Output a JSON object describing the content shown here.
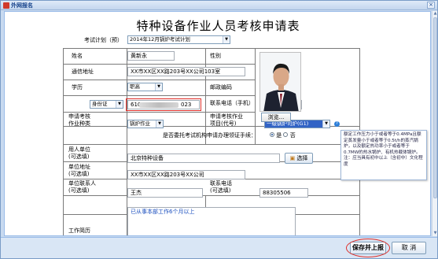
{
  "window": {
    "title": "外网报名",
    "close_glyph": "×"
  },
  "form": {
    "title": "特种设备作业人员考核申请表",
    "exam_plan_label": "考试计划（预）",
    "exam_plan_value": "2014年12月锅炉考试计划",
    "fields": {
      "name_label": "姓名",
      "name_value": "黄新永",
      "gender_label": "性别",
      "gender_male": "男",
      "gender_female": "女",
      "gender_selected": "female",
      "address_label": "通信地址",
      "address_value": "XX市XX区XX路203号XX公司103室",
      "education_label": "学历",
      "education_value": "职高",
      "postcode_label": "邮政编码",
      "postcode_value": "100000",
      "id_type_value": "身份证",
      "id_number_prefix": "610",
      "id_number_suffix": "023",
      "phone_label": "联系电话（手机）",
      "phone_value": "18900005500",
      "category_label_1": "申请考核",
      "category_label_2": "作业种类",
      "category_value": "锅炉作业",
      "project_label_1": "申请考核作业",
      "project_label_2": "项目(代号)",
      "project_value": "一级锅炉司炉(G1)",
      "entrust_label": "是否委托考试机构申请办理领证手续：",
      "entrust_yes": "是",
      "entrust_no": "否",
      "entrust_selected": "yes",
      "employer_label_1": "用人单位",
      "employer_label_2": "(可选填)",
      "employer_value": "北京特种设备",
      "choose_button": "选择",
      "employer_addr_label_1": "单位地址",
      "employer_addr_label_2": "(可选填)",
      "employer_addr_value": "XX市XX区XX路203号XX公司",
      "contact_label_1": "单位联系人",
      "contact_label_2": "(可选填)",
      "contact_value": "王杰",
      "contact_phone_label_1": "联系电话",
      "contact_phone_label_2": "(可选填)",
      "contact_phone_value": "88305506",
      "work_history_label": "工作简历",
      "work_history_value": "已从事本部工作6个月以上"
    },
    "photo_browse_button": "浏览...",
    "note_text": "额定工作压力小于或者等于0.4MPa且额定蒸发量小于或者等于0.5t/h的蒸汽锅炉，以及额定热功率小于或者等于0.7MW的热水锅炉、有机热载体锅炉。注：应当具有初中以上（含初中）文化程度"
  },
  "footer": {
    "save_submit": "保存并上报",
    "cancel": "取 消"
  },
  "colors": {
    "accent": "#15428b",
    "highlight_red": "#e0302b",
    "window_bg": "#c8daf0"
  }
}
